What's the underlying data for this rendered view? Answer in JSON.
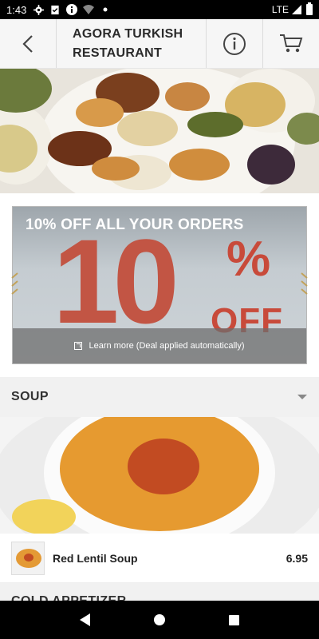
{
  "status_bar": {
    "time": "1:43",
    "network": "LTE",
    "icons": [
      "settings-icon",
      "clipboard-check-icon",
      "info-icon",
      "wifi-icon",
      "dot-icon"
    ]
  },
  "header": {
    "title": "AGORA TURKISH\nRESTAURANT",
    "back_icon": "back-chevron-icon",
    "info_icon": "info-icon",
    "cart_icon": "cart-icon"
  },
  "deal": {
    "title": "10% OFF ALL YOUR ORDERS",
    "big_number": "10",
    "percent": "%",
    "off_text": "OFF",
    "footer_text": "Learn more (Deal applied automatically)"
  },
  "category": {
    "label": "SOUP",
    "next_label": "COLD APPETIZER"
  },
  "item": {
    "name": "Red Lentil Soup",
    "price": "6.95"
  },
  "colors": {
    "deal_red": "#c84a3a",
    "header_bg": "#f5f5f5",
    "category_bg": "#f1f1f1"
  }
}
